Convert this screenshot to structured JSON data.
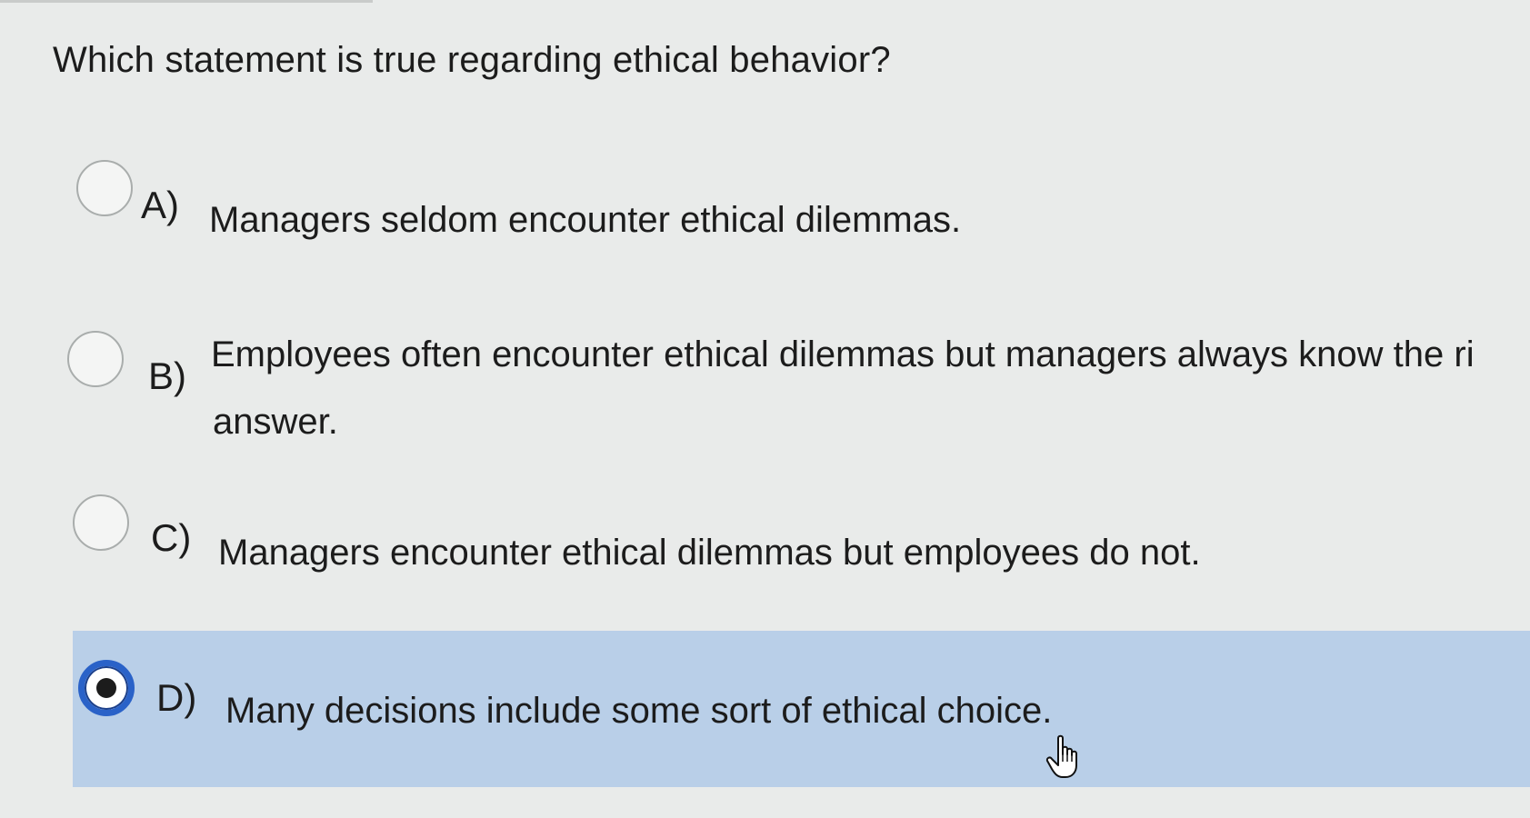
{
  "question": "Which statement is true regarding ethical behavior?",
  "options": [
    {
      "letter": "A)",
      "text": "Managers seldom encounter ethical dilemmas.",
      "selected": false
    },
    {
      "letter": "B)",
      "text": "Employees often encounter ethical dilemmas but managers always know the ri",
      "text_line2": "answer.",
      "selected": false
    },
    {
      "letter": "C)",
      "text": "Managers encounter ethical dilemmas but employees do not.",
      "selected": false
    },
    {
      "letter": "D)",
      "text": "Many decisions include some sort of ethical choice.",
      "selected": true
    }
  ],
  "colors": {
    "background": "#e9ebea",
    "selection_highlight": "#b9cfe8",
    "radio_selected": "#2a62c8"
  },
  "icons": {
    "cursor": "hand-pointer-icon"
  }
}
